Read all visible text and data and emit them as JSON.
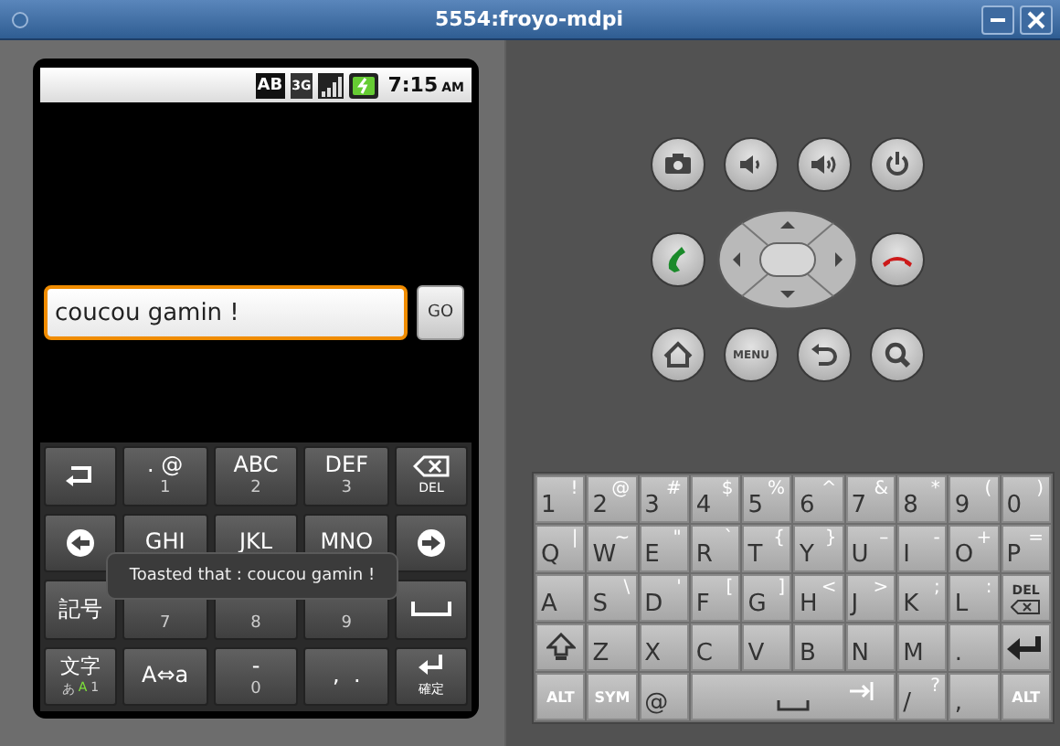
{
  "window": {
    "title": "5554:froyo-mdpi"
  },
  "status_bar": {
    "badges": [
      "AB",
      "3G"
    ],
    "time": "7:15",
    "meridiem": "AM"
  },
  "text_field": {
    "value": "coucou gamin !",
    "focused": true
  },
  "go_button": {
    "label": "GO"
  },
  "soft_keyboard": {
    "keys": [
      {
        "kind": "return"
      },
      {
        "kind": "text",
        "main": ". @",
        "sub": "1"
      },
      {
        "kind": "text",
        "main": "ABC",
        "sub": "2"
      },
      {
        "kind": "text",
        "main": "DEF",
        "sub": "3"
      },
      {
        "kind": "delete",
        "label": "DEL"
      },
      {
        "kind": "cursor_left"
      },
      {
        "kind": "text",
        "main": "GHI"
      },
      {
        "kind": "text",
        "main": "JKL"
      },
      {
        "kind": "text",
        "main": "MNO"
      },
      {
        "kind": "cursor_right"
      },
      {
        "kind": "text",
        "main": "記号"
      },
      {
        "kind": "text",
        "sub": "7"
      },
      {
        "kind": "text",
        "sub": "8"
      },
      {
        "kind": "text",
        "sub": "9"
      },
      {
        "kind": "space"
      },
      {
        "kind": "mode",
        "label": "文字",
        "modes": [
          {
            "label": "あ",
            "selected": false
          },
          {
            "label": "A",
            "selected": true
          },
          {
            "label": "1",
            "selected": false
          }
        ]
      },
      {
        "kind": "text",
        "main": "A⇔a"
      },
      {
        "kind": "text",
        "main": "-",
        "sub": "0"
      },
      {
        "kind": "text",
        "main": ",  ."
      },
      {
        "kind": "enter",
        "label": "確定"
      }
    ]
  },
  "toast": {
    "text": "Toasted that : coucou gamin !"
  },
  "device_buttons": [
    {
      "kind": "camera"
    },
    {
      "kind": "volume_down"
    },
    {
      "kind": "volume_up"
    },
    {
      "kind": "power"
    },
    {
      "kind": "call"
    },
    {
      "kind": "dpad"
    },
    {
      "kind": "end_call"
    },
    {
      "kind": "home"
    },
    {
      "kind": "menu",
      "label": "MENU"
    },
    {
      "kind": "back"
    },
    {
      "kind": "search"
    }
  ],
  "hardware_keyboard": {
    "keys": [
      {
        "kind": "text",
        "main": "1",
        "alt": "!"
      },
      {
        "kind": "text",
        "main": "2",
        "alt": "@"
      },
      {
        "kind": "text",
        "main": "3",
        "alt": "#"
      },
      {
        "kind": "text",
        "main": "4",
        "alt": "$"
      },
      {
        "kind": "text",
        "main": "5",
        "alt": "%"
      },
      {
        "kind": "text",
        "main": "6",
        "alt": "^"
      },
      {
        "kind": "text",
        "main": "7",
        "alt": "&"
      },
      {
        "kind": "text",
        "main": "8",
        "alt": "*"
      },
      {
        "kind": "text",
        "main": "9",
        "alt": "("
      },
      {
        "kind": "text",
        "main": "0",
        "alt": ")"
      },
      {
        "kind": "text",
        "main": "Q",
        "alt": "|"
      },
      {
        "kind": "text",
        "main": "W",
        "alt": "~"
      },
      {
        "kind": "text",
        "main": "E",
        "alt": "\""
      },
      {
        "kind": "text",
        "main": "R",
        "alt": "`"
      },
      {
        "kind": "text",
        "main": "T",
        "alt": "{"
      },
      {
        "kind": "text",
        "main": "Y",
        "alt": "}"
      },
      {
        "kind": "text",
        "main": "U",
        "alt": "–"
      },
      {
        "kind": "text",
        "main": "I",
        "alt": "-"
      },
      {
        "kind": "text",
        "main": "O",
        "alt": "+"
      },
      {
        "kind": "text",
        "main": "P",
        "alt": "="
      },
      {
        "kind": "text",
        "main": "A"
      },
      {
        "kind": "text",
        "main": "S",
        "alt": "\\"
      },
      {
        "kind": "text",
        "main": "D",
        "alt": "'"
      },
      {
        "kind": "text",
        "main": "F",
        "alt": "["
      },
      {
        "kind": "text",
        "main": "G",
        "alt": "]"
      },
      {
        "kind": "text",
        "main": "H",
        "alt": "<"
      },
      {
        "kind": "text",
        "main": "J",
        "alt": ">"
      },
      {
        "kind": "text",
        "main": "K",
        "alt": ";"
      },
      {
        "kind": "text",
        "main": "L",
        "alt": ":"
      },
      {
        "kind": "delete",
        "label": "DEL"
      },
      {
        "kind": "shift"
      },
      {
        "kind": "text",
        "main": "Z"
      },
      {
        "kind": "text",
        "main": "X"
      },
      {
        "kind": "text",
        "main": "C"
      },
      {
        "kind": "text",
        "main": "V"
      },
      {
        "kind": "text",
        "main": "B"
      },
      {
        "kind": "text",
        "main": "N"
      },
      {
        "kind": "text",
        "main": "M"
      },
      {
        "kind": "text",
        "main": "."
      },
      {
        "kind": "enter"
      },
      {
        "kind": "modifier",
        "label": "ALT"
      },
      {
        "kind": "modifier",
        "label": "SYM"
      },
      {
        "kind": "text",
        "main": "@"
      },
      {
        "kind": "space"
      },
      {
        "kind": "text",
        "main": "/",
        "alt": "?"
      },
      {
        "kind": "text",
        "main": ","
      },
      {
        "kind": "modifier",
        "label": "ALT"
      }
    ]
  }
}
